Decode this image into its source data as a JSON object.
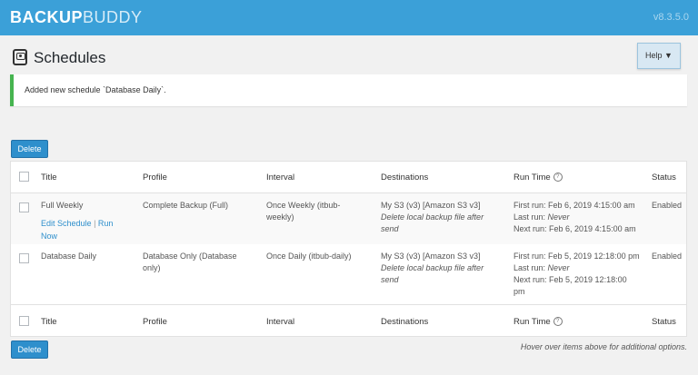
{
  "app": {
    "logo_bold": "BACKUP",
    "logo_light": "BUDDY",
    "version": "v8.3.5.0"
  },
  "page": {
    "title": "Schedules",
    "help_label": "Help ▼"
  },
  "notice": {
    "text": "Added new schedule `Database Daily`."
  },
  "actions": {
    "delete_label": "Delete"
  },
  "table": {
    "columns": [
      "Title",
      "Profile",
      "Interval",
      "Destinations",
      "Run Time",
      "Status"
    ],
    "rows": [
      {
        "title": "Full Weekly",
        "edit_label": "Edit Schedule",
        "sep": "|",
        "run_label_1": "Run",
        "run_label_2": "Now",
        "profile": "Complete Backup (Full)",
        "interval_1": "Once Weekly (itbub-",
        "interval_2": "weekly)",
        "dest_1": "My S3 (v3) [Amazon S3 v3]",
        "dest_2": "Delete local backup file after",
        "dest_3": "send",
        "first_run": "First run: Feb 6, 2019 4:15:00 am",
        "last_run_label": "Last run: ",
        "last_run_value": "Never",
        "next_run_1": "Next run: Feb 6, 2019 4:15:00 am",
        "next_run_2": "",
        "status": "Enabled"
      },
      {
        "title": "Database Daily",
        "profile_1": "Database Only (Database",
        "profile_2": "only)",
        "interval": "Once Daily (itbub-daily)",
        "dest_1": "My S3 (v3) [Amazon S3 v3]",
        "dest_2": "Delete local backup file after",
        "dest_3": "send",
        "first_run": "First run: Feb 5, 2019 12:18:00 pm",
        "last_run_label": "Last run: ",
        "last_run_value": "Never",
        "next_run_1": "Next run: Feb 5, 2019 12:18:00",
        "next_run_2": "pm",
        "status": "Enabled"
      }
    ]
  },
  "footer_hint": "Hover over items above for additional options.",
  "icons": {
    "schedules": "backup-drive-icon",
    "help": "chevron-down-icon",
    "runtime_help": "question-icon"
  },
  "colors": {
    "topbar": "#3ba0d8",
    "accent": "#2e8fcc",
    "notice_border": "#46b450"
  }
}
